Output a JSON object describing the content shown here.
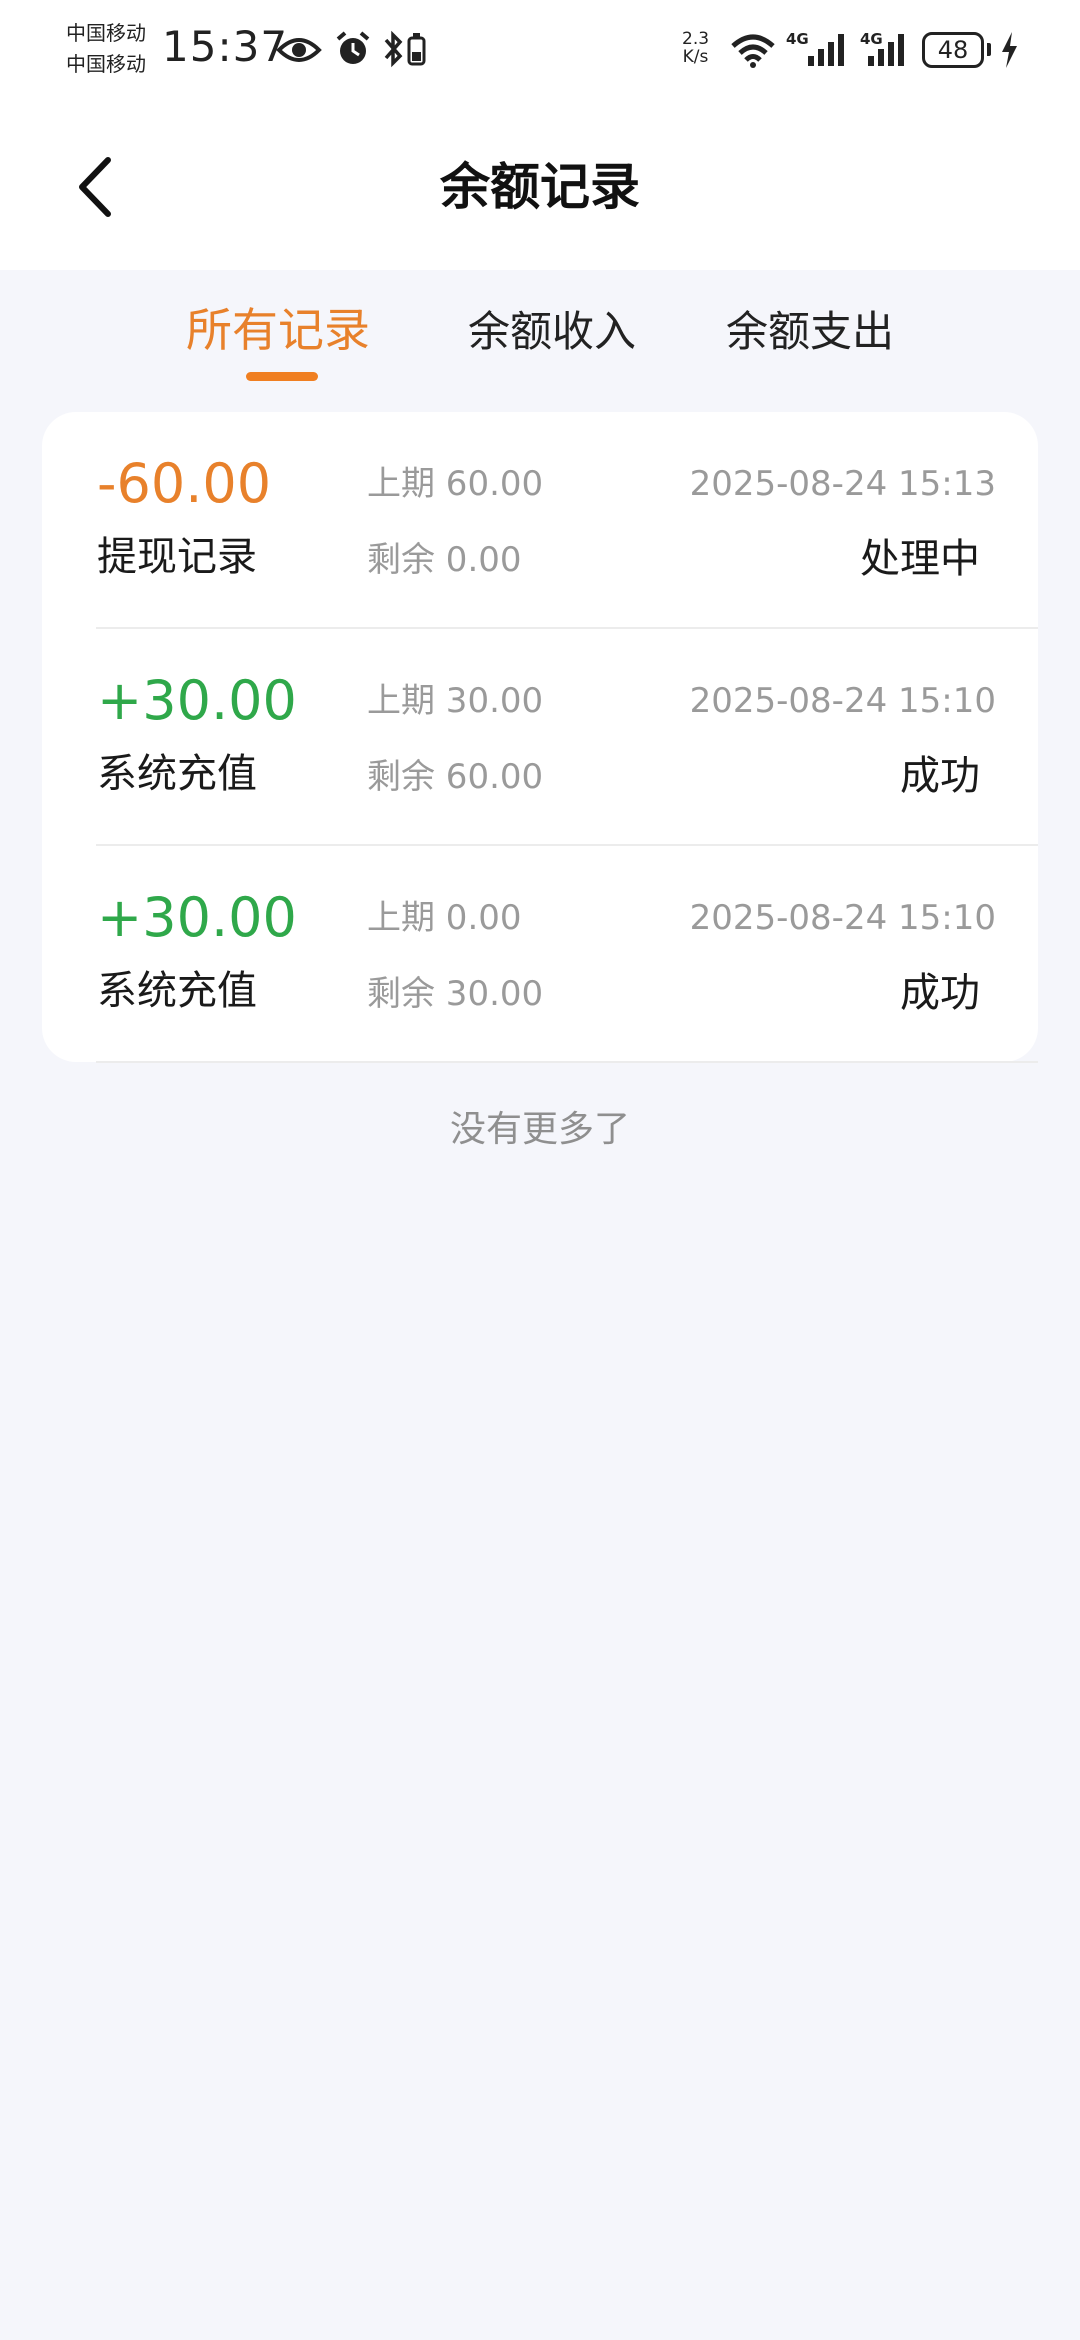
{
  "status_bar": {
    "carrier_1": "中国移动",
    "carrier_2": "中国移动",
    "time": "15:37",
    "net_speed_value": "2.3",
    "net_speed_unit": "K/s",
    "signal_1_label": "4G",
    "signal_2_label": "4G",
    "battery": "48",
    "icons": [
      "eye-icon",
      "alarm-icon",
      "bluetooth-battery-icon",
      "wifi-icon",
      "signal-icon",
      "signal-icon",
      "battery-icon",
      "charging-icon"
    ]
  },
  "header": {
    "title": "余额记录",
    "back_icon": "chevron-left-icon"
  },
  "tabs": [
    {
      "label": "所有记录",
      "active": true
    },
    {
      "label": "余额收入",
      "active": false
    },
    {
      "label": "余额支出",
      "active": false
    }
  ],
  "records": [
    {
      "amount": "-60.00",
      "type": "提现记录",
      "prev": "上期 60.00",
      "remain": "剩余 0.00",
      "time": "2025-08-24 15:13",
      "status": "处理中",
      "amount_color": "#e8812b"
    },
    {
      "amount": "+30.00",
      "type": "系统充值",
      "prev": "上期 30.00",
      "remain": "剩余 60.00",
      "time": "2025-08-24 15:10",
      "status": "成功",
      "amount_color": "#2fa84a"
    },
    {
      "amount": "+30.00",
      "type": "系统充值",
      "prev": "上期 0.00",
      "remain": "剩余 30.00",
      "time": "2025-08-24 15:10",
      "status": "成功",
      "amount_color": "#2fa84a"
    }
  ],
  "footer": {
    "no_more": "没有更多了"
  },
  "colors": {
    "accent": "#e8812b",
    "income": "#2fa84a",
    "background": "#f5f6fb"
  }
}
